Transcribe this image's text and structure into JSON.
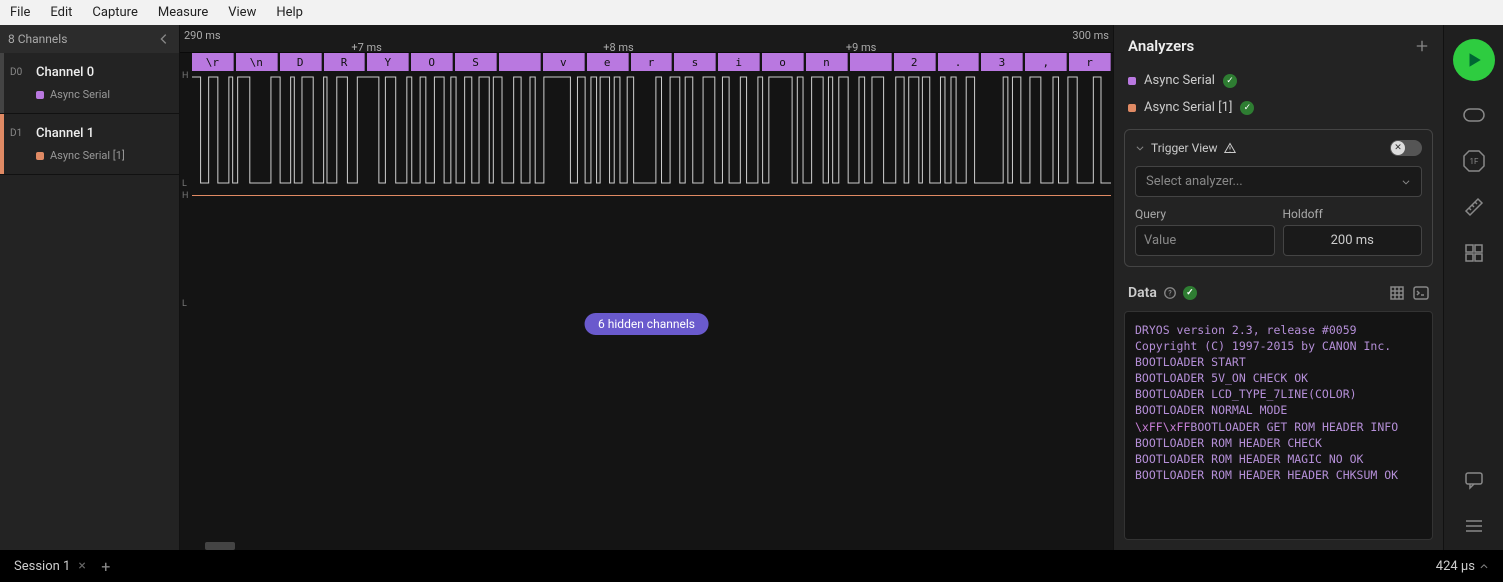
{
  "menu": {
    "file": "File",
    "edit": "Edit",
    "capture": "Capture",
    "measure": "Measure",
    "view": "View",
    "help": "Help"
  },
  "sidebar": {
    "header": "8 Channels",
    "ch0": {
      "idx": "D0",
      "name": "Channel 0",
      "analyzer": "Async Serial",
      "color": "#b978e0"
    },
    "ch1": {
      "idx": "D1",
      "name": "Channel 1",
      "analyzer": "Async Serial [1]",
      "color": "#e08a64"
    }
  },
  "timeline": {
    "left_edge": "290 ms",
    "right_edge": "300 ms",
    "ticks": [
      {
        "label": "+7 ms",
        "pos": 20
      },
      {
        "label": "+8 ms",
        "pos": 47
      },
      {
        "label": "+9 ms",
        "pos": 73
      }
    ],
    "decoded": [
      "\\r",
      "\\n",
      "D",
      "R",
      "Y",
      "O",
      "S",
      " ",
      "v",
      "e",
      "r",
      "s",
      "i",
      "o",
      "n",
      " ",
      "2",
      ".",
      "3",
      ",",
      "r"
    ]
  },
  "hidden_pill": "6 hidden channels",
  "analyzers": {
    "title": "Analyzers",
    "items": [
      {
        "name": "Async Serial",
        "color": "#b978e0"
      },
      {
        "name": "Async Serial [1]",
        "color": "#e08a64"
      }
    ],
    "trigger": {
      "title": "Trigger View",
      "select_placeholder": "Select analyzer...",
      "query_label": "Query",
      "query_placeholder": "Value",
      "holdoff_label": "Holdoff",
      "holdoff_value": "200 ms"
    }
  },
  "data_section": {
    "title": "Data",
    "lines": [
      "DRYOS version 2.3, release #0059",
      "Copyright (C) 1997-2015 by CANON Inc.",
      "BOOTLOADER START",
      "BOOTLOADER 5V_ON CHECK OK",
      "BOOTLOADER LCD_TYPE_7LINE(COLOR)",
      "BOOTLOADER NORMAL MODE",
      "\\xFF\\xFFBOOTLOADER GET ROM HEADER INFO",
      "BOOTLOADER ROM HEADER CHECK",
      "BOOTLOADER ROM HEADER MAGIC NO OK",
      "BOOTLOADER ROM HEADER HEADER CHKSUM OK"
    ]
  },
  "session": {
    "name": "Session 1",
    "right_time": "424 µs"
  }
}
